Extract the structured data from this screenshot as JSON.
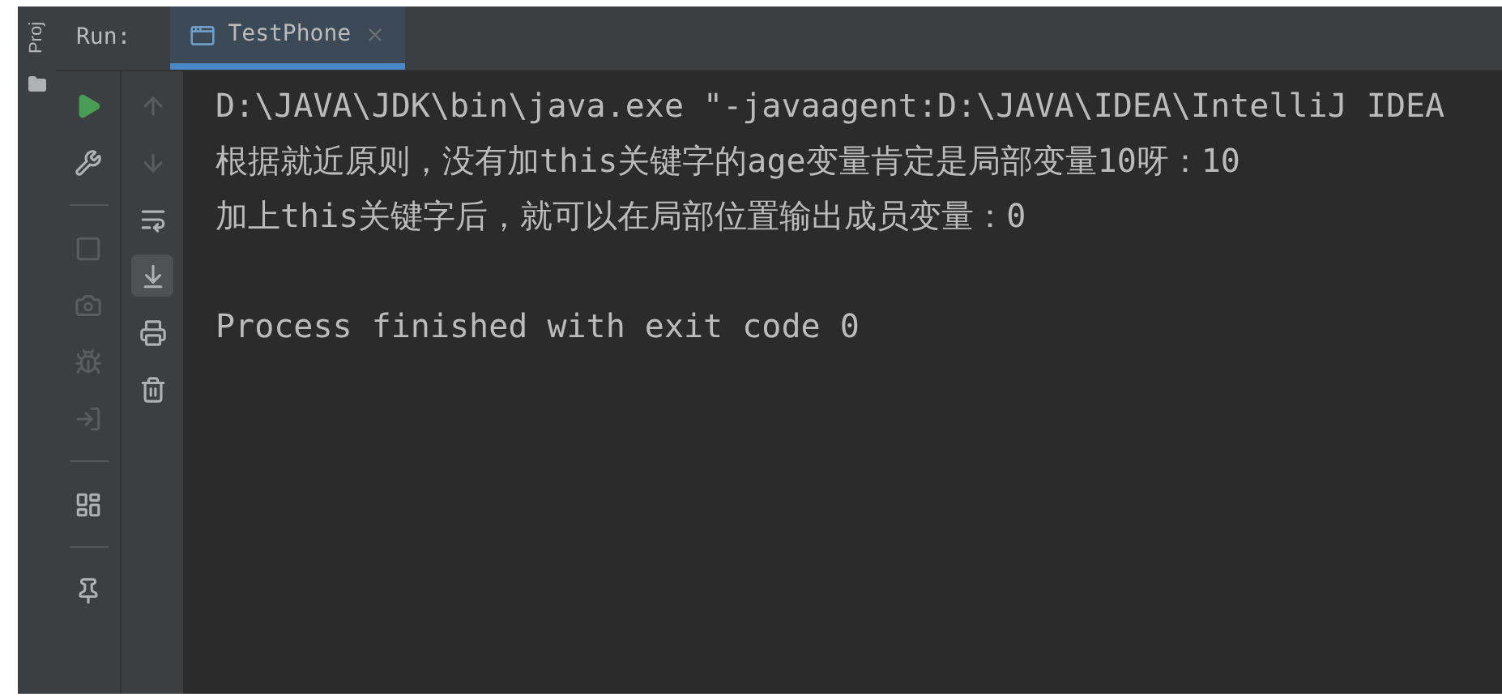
{
  "side_tab": {
    "label": "Proj"
  },
  "run_header": {
    "label": "Run:",
    "tabs": [
      {
        "label": "TestPhone",
        "selected": true
      }
    ]
  },
  "toolbar_left": [
    {
      "kind": "rerun",
      "disabled": false
    },
    {
      "kind": "settings",
      "disabled": false
    },
    {
      "kind": "stop",
      "disabled": true
    },
    {
      "kind": "camera",
      "disabled": true
    },
    {
      "kind": "debug",
      "disabled": true
    },
    {
      "kind": "attach",
      "disabled": true
    },
    {
      "kind": "layout",
      "disabled": false
    },
    {
      "kind": "pin",
      "disabled": false
    }
  ],
  "toolbar_right": [
    {
      "kind": "up",
      "disabled": true,
      "selected": false
    },
    {
      "kind": "down",
      "disabled": true,
      "selected": false
    },
    {
      "kind": "wrap",
      "disabled": false,
      "selected": false
    },
    {
      "kind": "scroll-end",
      "disabled": false,
      "selected": true
    },
    {
      "kind": "print",
      "disabled": false,
      "selected": false
    },
    {
      "kind": "trash",
      "disabled": false,
      "selected": false
    }
  ],
  "console_lines": [
    {
      "kind": "output",
      "text": "D:\\JAVA\\JDK\\bin\\java.exe \"-javaagent:D:\\JAVA\\IDEA\\IntelliJ IDEA"
    },
    {
      "kind": "output",
      "text": "根据就近原则，没有加this关键字的age变量肯定是局部变量10呀：10"
    },
    {
      "kind": "output",
      "text": "加上this关键字后，就可以在局部位置输出成员变量：0"
    },
    {
      "kind": "exit",
      "text": "Process finished with exit code 0"
    }
  ]
}
